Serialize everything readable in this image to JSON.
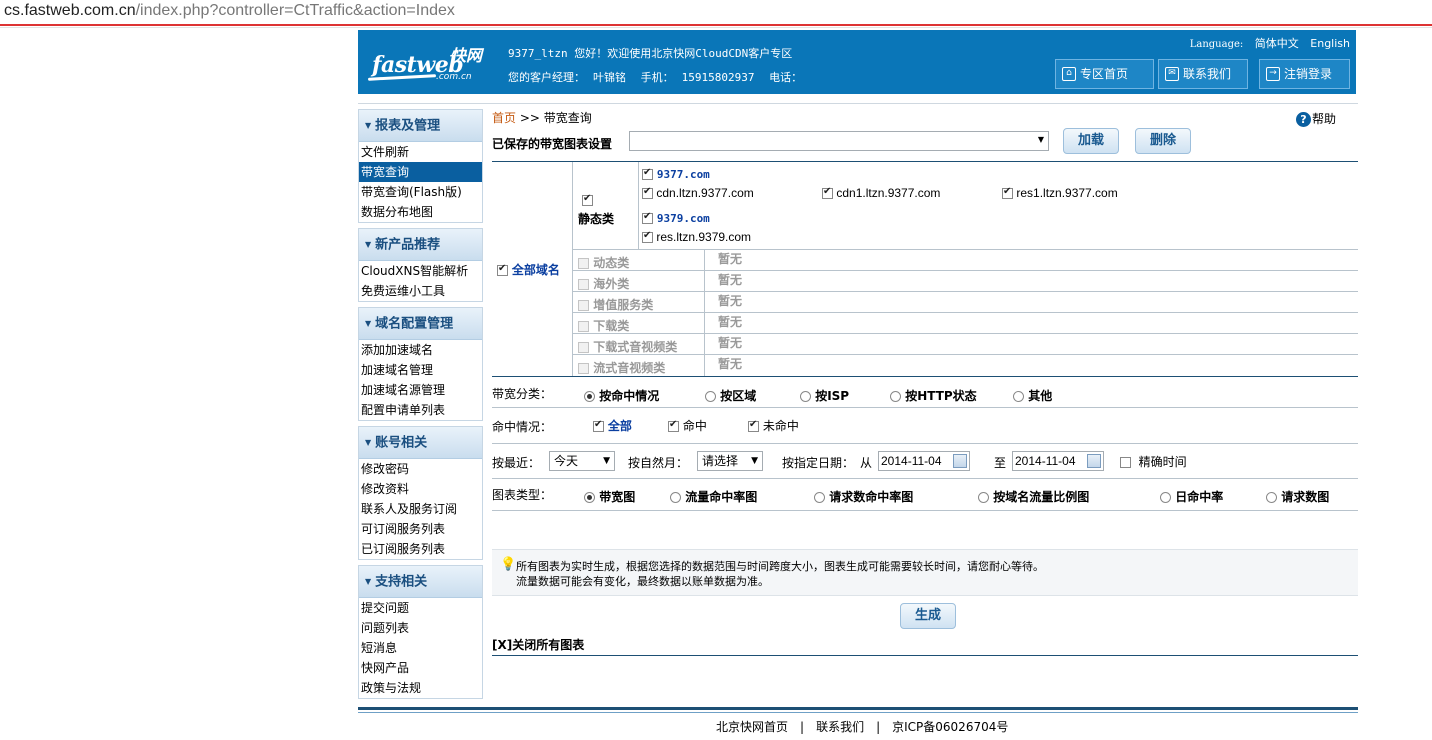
{
  "browser": {
    "url_host": "cs.fastweb.com.cn",
    "url_path": "/index.php?controller=CtTraffic&action=Index"
  },
  "header": {
    "logo_text": "fastweb",
    "logo_cn": "快网",
    "logo_sub": ".com.cn",
    "welcome": "9377_ltzn 您好！欢迎使用北京快网CloudCDN客户专区",
    "manager_label": "您的客户经理：",
    "manager_name": "叶锦铭",
    "mobile_label": "手机：",
    "mobile": "15915802937",
    "phone_label": "电话：",
    "language_label": "Language:",
    "lang_cn": "简体中文",
    "lang_en": "English",
    "btn_home": "专区首页",
    "btn_contact": "联系我们",
    "btn_logout": "注销登录"
  },
  "sidebar": {
    "groups": [
      {
        "title": "报表及管理",
        "items": [
          "文件刷新",
          "带宽查询",
          "带宽查询(Flash版)",
          "数据分布地图"
        ]
      },
      {
        "title": "新产品推荐",
        "items": [
          "CloudXNS智能解析",
          "免费运维小工具"
        ]
      },
      {
        "title": "域名配置管理",
        "items": [
          "添加加速域名",
          "加速域名管理",
          "加速域名源管理",
          "配置申请单列表"
        ]
      },
      {
        "title": "账号相关",
        "items": [
          "修改密码",
          "修改资料",
          "联系人及服务订阅",
          "可订阅服务列表",
          "已订阅服务列表"
        ]
      },
      {
        "title": "支持相关",
        "items": [
          "提交问题",
          "问题列表",
          "短消息",
          "快网产品",
          "政策与法规"
        ]
      }
    ]
  },
  "main": {
    "breadcrumb_home": "首页",
    "breadcrumb_sep": ">>",
    "breadcrumb_current": "带宽查询",
    "help": "帮助",
    "saved_label": "已保存的带宽图表设置",
    "saved_value": "",
    "btn_load": "加载",
    "btn_delete": "删除",
    "all_domains": "全部域名",
    "static_label": "静态类",
    "static_groups": [
      {
        "name": "9377.com",
        "domains": [
          "cdn.ltzn.9377.com",
          "cdn1.ltzn.9377.com",
          "res1.ltzn.9377.com"
        ]
      },
      {
        "name": "9379.com",
        "domains": [
          "res.ltzn.9379.com"
        ]
      }
    ],
    "other_categories": [
      "动态类",
      "海外类",
      "增值服务类",
      "下载类",
      "下载式音视频类",
      "流式音视频类"
    ],
    "none_text": "暂无",
    "bw_class_label": "带宽分类：",
    "bw_classes": [
      "按命中情况",
      "按区域",
      "按ISP",
      "按HTTP状态",
      "其他"
    ],
    "hit_label": "命中情况：",
    "hit_options": [
      "全部",
      "命中",
      "未命中"
    ],
    "recent_label": "按最近：",
    "recent_value": "今天",
    "natural_month_label": "按自然月：",
    "natural_month_value": "请选择",
    "date_label": "按指定日期：",
    "from_label": "从",
    "from_date": "2014-11-04",
    "to_label": "至",
    "to_date": "2014-11-04",
    "precise_time": "精确时间",
    "chart_type_label": "图表类型：",
    "chart_types": [
      "带宽图",
      "流量命中率图",
      "请求数命中率图",
      "按域名流量比例图",
      "日命中率",
      "请求数图"
    ],
    "tip_line1": "所有图表为实时生成，根据您选择的数据范围与时间跨度大小，图表生成可能需要较长时间，请您耐心等待。",
    "tip_line2": "流量数据可能会有变化，最终数据以账单数据为准。",
    "btn_generate": "生成",
    "close_all": "[X]关闭所有图表"
  },
  "footer": {
    "link1": "北京快网首页",
    "link2": "联系我们",
    "icp": "京ICP备06026704号",
    "sep": "|"
  }
}
